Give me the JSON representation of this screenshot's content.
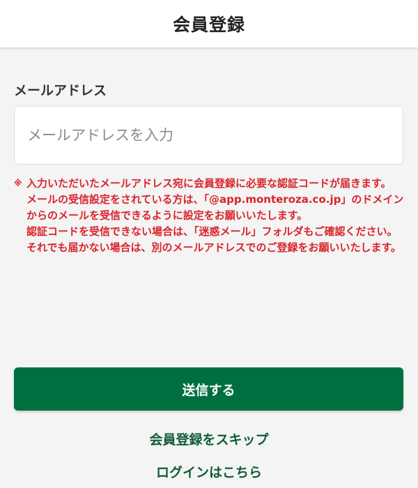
{
  "header": {
    "title": "会員登録"
  },
  "form": {
    "email_label": "メールアドレス",
    "email_placeholder": "メールアドレスを入力",
    "email_value": ""
  },
  "notice": {
    "mark": "※",
    "lines": [
      "入力いただいたメールアドレス宛に会員登録に必要な認証コードが届きます。",
      "メールの受信設定をされている方は、「@app.monteroza.co.jp」のドメインからのメールを受信できるように設定をお願いいたします。",
      "認証コードを受信できない場合は、「迷惑メール」フォルダもご確認ください。",
      "それでも届かない場合は、別のメールアドレスでのご登録をお願いいたします。"
    ]
  },
  "actions": {
    "submit_label": "送信する",
    "skip_label": "会員登録をスキップ",
    "login_label": "ログインはこちら"
  },
  "colors": {
    "primary_green": "#006f3f",
    "link_green": "#0f5c36",
    "notice_red": "#d9242b"
  }
}
